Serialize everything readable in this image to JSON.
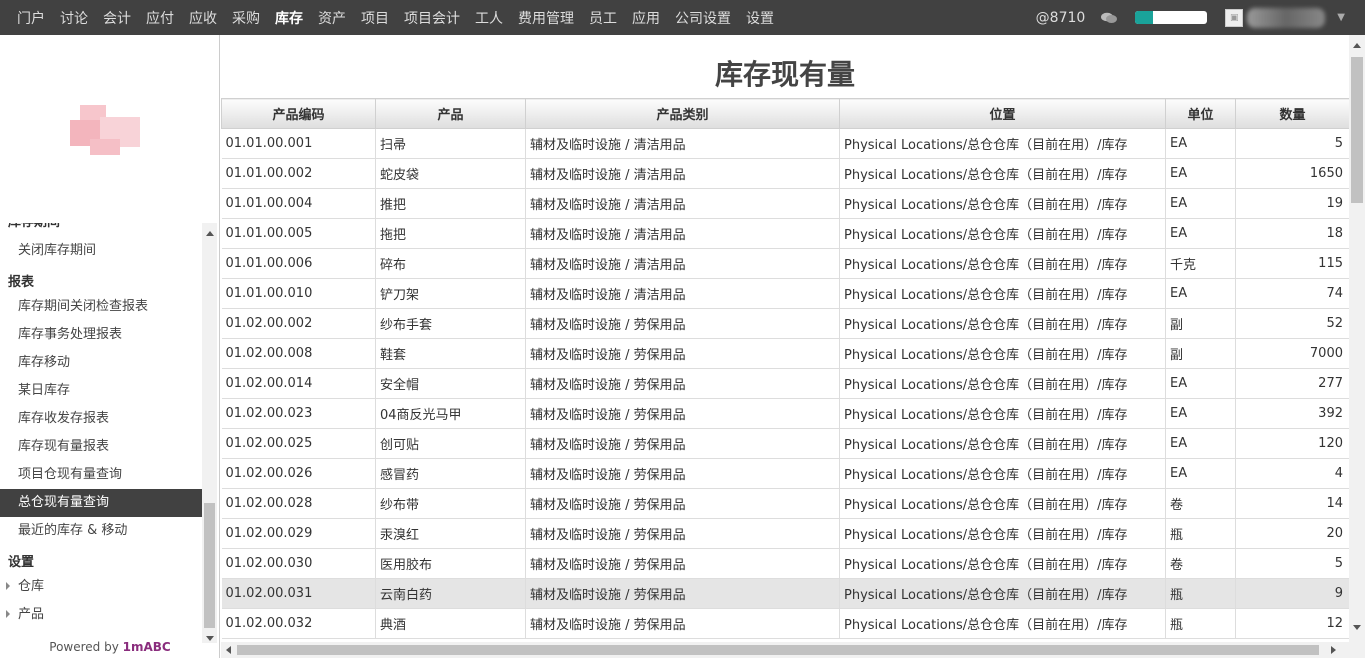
{
  "nav": {
    "items": [
      "门户",
      "讨论",
      "会计",
      "应付",
      "应收",
      "采购",
      "库存",
      "资产",
      "项目",
      "项目会计",
      "工人",
      "费用管理",
      "员工",
      "应用",
      "公司设置",
      "设置"
    ],
    "active": "库存",
    "at_count": "@8710",
    "progress_pct": 0.25
  },
  "sidebar": {
    "partial_header": "库存期间",
    "items": [
      {
        "type": "sub",
        "label": "关闭库存期间"
      },
      {
        "type": "header",
        "label": "报表"
      },
      {
        "type": "sub",
        "label": "库存期间关闭检查报表"
      },
      {
        "type": "sub",
        "label": "库存事务处理报表"
      },
      {
        "type": "sub",
        "label": "库存移动"
      },
      {
        "type": "sub",
        "label": "某日库存"
      },
      {
        "type": "sub",
        "label": "库存收发存报表"
      },
      {
        "type": "sub",
        "label": "库存现有量报表"
      },
      {
        "type": "sub",
        "label": "项目仓现有量查询"
      },
      {
        "type": "sub",
        "label": "总仓现有量查询",
        "selected": true
      },
      {
        "type": "sub",
        "label": "最近的库存 & 移动"
      },
      {
        "type": "header",
        "label": "设置"
      },
      {
        "type": "tree",
        "label": "仓库"
      },
      {
        "type": "tree",
        "label": "产品"
      }
    ],
    "powered_prefix": "Powered by ",
    "powered_brand": "1mABC"
  },
  "page": {
    "title": "库存现有量"
  },
  "table": {
    "columns": [
      "产品编码",
      "产品",
      "产品类别",
      "位置",
      "单位",
      "数量"
    ],
    "rows": [
      [
        "01.01.00.001",
        "扫帚",
        "辅材及临时设施 / 清洁用品",
        "Physical Locations/总仓仓库（目前在用）/库存",
        "EA",
        "5"
      ],
      [
        "01.01.00.002",
        "蛇皮袋",
        "辅材及临时设施 / 清洁用品",
        "Physical Locations/总仓仓库（目前在用）/库存",
        "EA",
        "1650"
      ],
      [
        "01.01.00.004",
        "推把",
        "辅材及临时设施 / 清洁用品",
        "Physical Locations/总仓仓库（目前在用）/库存",
        "EA",
        "19"
      ],
      [
        "01.01.00.005",
        "拖把",
        "辅材及临时设施 / 清洁用品",
        "Physical Locations/总仓仓库（目前在用）/库存",
        "EA",
        "18"
      ],
      [
        "01.01.00.006",
        "碎布",
        "辅材及临时设施 / 清洁用品",
        "Physical Locations/总仓仓库（目前在用）/库存",
        "千克",
        "115"
      ],
      [
        "01.01.00.010",
        "铲刀架",
        "辅材及临时设施 / 清洁用品",
        "Physical Locations/总仓仓库（目前在用）/库存",
        "EA",
        "74"
      ],
      [
        "01.02.00.002",
        "纱布手套",
        "辅材及临时设施 / 劳保用品",
        "Physical Locations/总仓仓库（目前在用）/库存",
        "副",
        "52"
      ],
      [
        "01.02.00.008",
        "鞋套",
        "辅材及临时设施 / 劳保用品",
        "Physical Locations/总仓仓库（目前在用）/库存",
        "副",
        "7000"
      ],
      [
        "01.02.00.014",
        "安全帽",
        "辅材及临时设施 / 劳保用品",
        "Physical Locations/总仓仓库（目前在用）/库存",
        "EA",
        "277"
      ],
      [
        "01.02.00.023",
        "04商反光马甲",
        "辅材及临时设施 / 劳保用品",
        "Physical Locations/总仓仓库（目前在用）/库存",
        "EA",
        "392"
      ],
      [
        "01.02.00.025",
        "创可贴",
        "辅材及临时设施 / 劳保用品",
        "Physical Locations/总仓仓库（目前在用）/库存",
        "EA",
        "120"
      ],
      [
        "01.02.00.026",
        "感冒药",
        "辅材及临时设施 / 劳保用品",
        "Physical Locations/总仓仓库（目前在用）/库存",
        "EA",
        "4"
      ],
      [
        "01.02.00.028",
        "纱布带",
        "辅材及临时设施 / 劳保用品",
        "Physical Locations/总仓仓库（目前在用）/库存",
        "卷",
        "14"
      ],
      [
        "01.02.00.029",
        "汞溴红",
        "辅材及临时设施 / 劳保用品",
        "Physical Locations/总仓仓库（目前在用）/库存",
        "瓶",
        "20"
      ],
      [
        "01.02.00.030",
        "医用胶布",
        "辅材及临时设施 / 劳保用品",
        "Physical Locations/总仓仓库（目前在用）/库存",
        "卷",
        "5"
      ],
      [
        "01.02.00.031",
        "云南白药",
        "辅材及临时设施 / 劳保用品",
        "Physical Locations/总仓仓库（目前在用）/库存",
        "瓶",
        "9"
      ],
      [
        "01.02.00.032",
        "典酒",
        "辅材及临时设施 / 劳保用品",
        "Physical Locations/总仓仓库（目前在用）/库存",
        "瓶",
        "12"
      ]
    ],
    "highlighted_row": 15
  }
}
